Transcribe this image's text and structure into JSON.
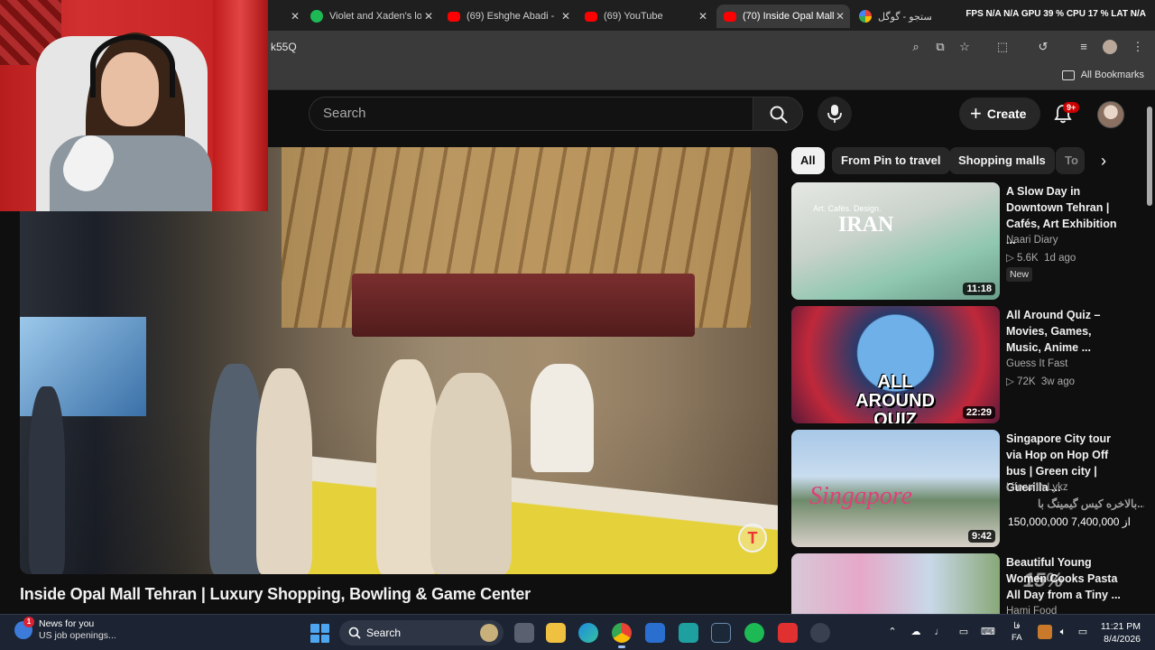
{
  "browser": {
    "tabs": [
      {
        "label": "",
        "icon": "generic-tab-icon",
        "color": "#888888"
      },
      {
        "label": "Violet and Xaden's lo",
        "icon": "spotify-icon",
        "color": "#1db954"
      },
      {
        "label": "(69) Eshghe Abadi -",
        "icon": "youtube-icon",
        "color": "#ff0000"
      },
      {
        "label": "(69) YouTube",
        "icon": "youtube-icon",
        "color": "#ff0000"
      },
      {
        "label": "(70) Inside Opal Mall",
        "icon": "youtube-icon",
        "color": "#ff0000"
      },
      {
        "label": "جستجو - گوگل",
        "icon": "google-icon",
        "color": "#4285f4"
      }
    ],
    "system_stats": "FPS N/A N/A  GPU 39 %  CPU 17 %  LAT N/A",
    "url": "k55Q",
    "bookmarks_label": "All Bookmarks"
  },
  "youtube": {
    "search_placeholder": "Search",
    "create_label": "Create",
    "notif_count": "9+",
    "chips": [
      "All",
      "From Pin to travel",
      "Shopping malls",
      "To"
    ],
    "video_title": "Inside Opal Mall Tehran | Luxury Shopping, Bowling & Game Center",
    "recommendations": [
      {
        "title": "A Slow Day in Downtown Tehran | Cafés, Art Exhibition ...",
        "channel": "Naari Diary",
        "views": "5.6K",
        "age": "1d ago",
        "badge": "New",
        "duration": "11:18",
        "thumb_text": "IRAN",
        "thumb_caption": "Art. Cafés. Design."
      },
      {
        "title": "All Around Quiz – Movies, Games, Music, Anime ...",
        "channel": "Guess It Fast",
        "views": "72K",
        "age": "3w ago",
        "badge": "",
        "duration": "22:29",
        "thumb_text": "ALL AROUND QUIZ",
        "thumb_caption": ""
      },
      {
        "title": "Singapore City tour via Hop on Hop Off bus | Green city | Guerilla ...",
        "channel": "Life with Lykz",
        "views": "",
        "age": "",
        "badge": "",
        "duration": "9:42",
        "thumb_text": "Singapore",
        "thumb_caption": ""
      },
      {
        "title": "Beautiful Young Women Cooks Pasta All Day from a Tiny ...",
        "channel": "Hami Food",
        "views": "",
        "age": "",
        "badge": "",
        "duration": "",
        "thumb_text": "",
        "thumb_caption": ""
      }
    ]
  },
  "overlay": {
    "donation_text_fa": "بالاخره کیس گیمینگ با...",
    "donation_amount": "150,000,000 از 7,400,000",
    "progress_pct": "15%"
  },
  "taskbar": {
    "news_title": "News for you",
    "news_sub": "US job openings...",
    "news_badge": "1",
    "search_label": "Search",
    "lang_top": "فا",
    "lang_bottom": "FA",
    "time": "11:21 PM",
    "date": "8/4/2026"
  }
}
